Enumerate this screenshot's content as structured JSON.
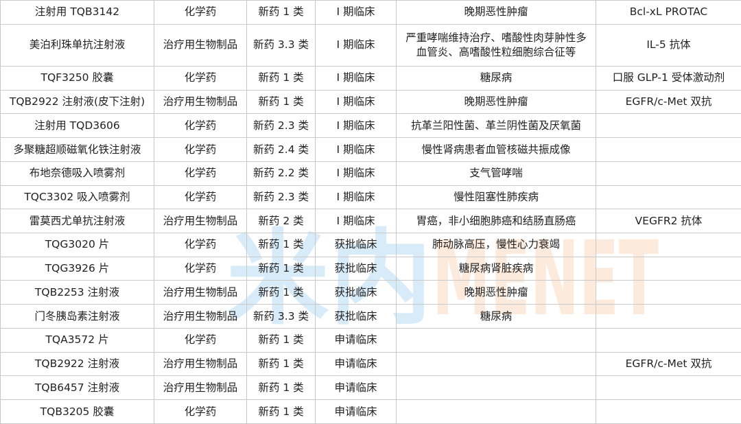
{
  "watermark": {
    "text": "米内MENET",
    "color_cn": "#8ec7ec",
    "color_en": "#f6b98a"
  },
  "rows": [
    {
      "name": "注射用 TQB3142",
      "category": "化学药",
      "reg_class": "新药 1 类",
      "stage": "I 期临床",
      "indication": "晚期恶性肿瘤",
      "target": "Bcl-xL PROTAC"
    },
    {
      "name": "美泊利珠单抗注射液",
      "category": "治疗用生物制品",
      "reg_class": "新药 3.3 类",
      "stage": "I 期临床",
      "indication": "严重哮喘维持治疗、嗜酸性肉芽肿性多血管炎、高嗜酸性粒细胞综合征等",
      "target": "IL-5 抗体"
    },
    {
      "name": "TQF3250 胶囊",
      "category": "化学药",
      "reg_class": "新药 1 类",
      "stage": "I 期临床",
      "indication": "糖尿病",
      "target": "口服 GLP-1 受体激动剂"
    },
    {
      "name": "TQB2922 注射液(皮下注射)",
      "category": "治疗用生物制品",
      "reg_class": "新药 1 类",
      "stage": "I 期临床",
      "indication": "晚期恶性肿瘤",
      "target": "EGFR/c-Met 双抗"
    },
    {
      "name": "注射用 TQD3606",
      "category": "化学药",
      "reg_class": "新药 2.3 类",
      "stage": "I 期临床",
      "indication": "抗革兰阳性菌、革兰阴性菌及厌氧菌",
      "target": ""
    },
    {
      "name": "多聚糖超顺磁氧化铁注射液",
      "category": "化学药",
      "reg_class": "新药 2.4 类",
      "stage": "I 期临床",
      "indication": "慢性肾病患者血管核磁共振成像",
      "target": ""
    },
    {
      "name": "布地奈德吸入喷雾剂",
      "category": "化学药",
      "reg_class": "新药 2.2 类",
      "stage": "I 期临床",
      "indication": "支气管哮喘",
      "target": ""
    },
    {
      "name": "TQC3302 吸入喷雾剂",
      "category": "化学药",
      "reg_class": "新药 2.3 类",
      "stage": "I 期临床",
      "indication": "慢性阻塞性肺疾病",
      "target": ""
    },
    {
      "name": "雷莫西尤单抗注射液",
      "category": "治疗用生物制品",
      "reg_class": "新药 2 类",
      "stage": "I 期临床",
      "indication": "胃癌，非小细胞肺癌和结肠直肠癌",
      "target": "VEGFR2 抗体"
    },
    {
      "name": "TQG3020 片",
      "category": "化学药",
      "reg_class": "新药 1 类",
      "stage": "获批临床",
      "indication": "肺动脉高压，慢性心力衰竭",
      "target": ""
    },
    {
      "name": "TQG3926 片",
      "category": "化学药",
      "reg_class": "新药 1 类",
      "stage": "获批临床",
      "indication": "糖尿病肾脏疾病",
      "target": ""
    },
    {
      "name": "TQB2253 注射液",
      "category": "治疗用生物制品",
      "reg_class": "新药 1 类",
      "stage": "获批临床",
      "indication": "晚期恶性肿瘤",
      "target": ""
    },
    {
      "name": "门冬胰岛素注射液",
      "category": "治疗用生物制品",
      "reg_class": "新药 3.3 类",
      "stage": "获批临床",
      "indication": "糖尿病",
      "target": ""
    },
    {
      "name": "TQA3572 片",
      "category": "化学药",
      "reg_class": "新药 1 类",
      "stage": "申请临床",
      "indication": "",
      "target": ""
    },
    {
      "name": "TQB2922 注射液",
      "category": "治疗用生物制品",
      "reg_class": "新药 1 类",
      "stage": "申请临床",
      "indication": "",
      "target": "EGFR/c-Met 双抗"
    },
    {
      "name": "TQB6457 注射液",
      "category": "治疗用生物制品",
      "reg_class": "新药 1 类",
      "stage": "申请临床",
      "indication": "",
      "target": ""
    },
    {
      "name": "TQB3205 胶囊",
      "category": "化学药",
      "reg_class": "新药 1 类",
      "stage": "申请临床",
      "indication": "",
      "target": ""
    }
  ]
}
